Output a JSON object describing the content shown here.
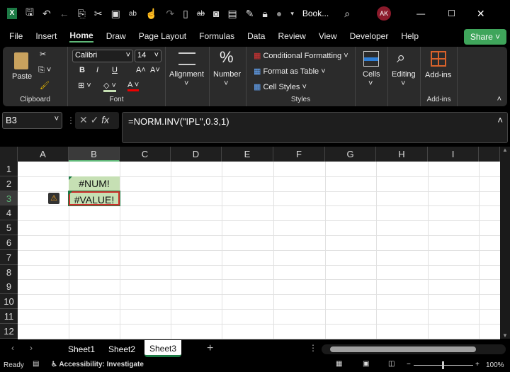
{
  "title_bar": {
    "app_icon": "excel-icon",
    "doc_title": "Book...",
    "user_initials": "AK",
    "qa_icons": [
      "save-icon",
      "undo-icon",
      "back-icon",
      "copy-icon",
      "cut-icon",
      "image-icon",
      "spelling-icon",
      "touch-icon",
      "redo-icon",
      "new-icon",
      "strikethrough-icon",
      "camera-icon",
      "form-icon",
      "format-painter-icon",
      "lock-icon",
      "record-icon",
      "customize-icon"
    ]
  },
  "menu": {
    "items": [
      "File",
      "Insert",
      "Home",
      "Draw",
      "Page Layout",
      "Formulas",
      "Data",
      "Review",
      "View",
      "Developer",
      "Help"
    ],
    "active": "Home",
    "share": "Share"
  },
  "ribbon": {
    "clipboard": {
      "paste": "Paste",
      "label": "Clipboard"
    },
    "font": {
      "name": "Calibri",
      "size": "14",
      "label": "Font",
      "bold": "B",
      "italic": "I",
      "underline": "U"
    },
    "alignment": "Alignment",
    "number": "Number",
    "styles": {
      "conditional": "Conditional Formatting",
      "format_table": "Format as Table",
      "cell_styles": "Cell Styles",
      "label": "Styles"
    },
    "cells": "Cells",
    "editing": "Editing",
    "addins": "Add-ins",
    "addins_label": "Add-ins"
  },
  "formula_bar": {
    "name_box": "B3",
    "fx": "fx",
    "formula": "=NORM.INV(\"IPL\",0.3,1)"
  },
  "grid": {
    "columns": [
      "A",
      "B",
      "C",
      "D",
      "E",
      "F",
      "G",
      "H",
      "I"
    ],
    "rows": [
      "1",
      "2",
      "3",
      "4",
      "5",
      "6",
      "7",
      "8",
      "9",
      "10",
      "11",
      "12"
    ],
    "selected": "B3",
    "cells": {
      "B2": "#NUM!",
      "B3": "#VALUE!"
    },
    "error_fill": "#c6e0b4",
    "highlight_border": "#d0312d"
  },
  "sheets": {
    "tabs": [
      "Sheet1",
      "Sheet2",
      "Sheet3"
    ],
    "active": "Sheet3",
    "add": "+"
  },
  "status": {
    "ready": "Ready",
    "accessibility": "Accessibility: Investigate",
    "zoom": "100%"
  }
}
